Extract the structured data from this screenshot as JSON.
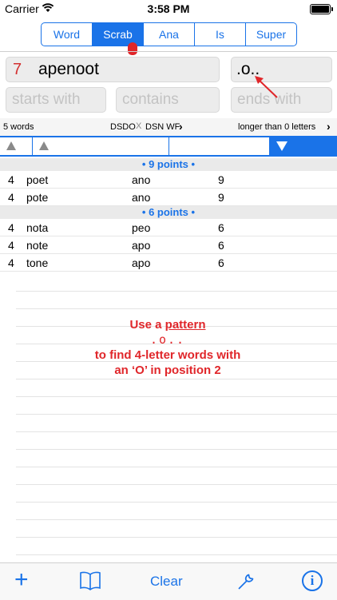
{
  "status_bar": {
    "carrier": "Carrier",
    "time": "3:58 PM"
  },
  "mode_tabs": [
    "Word",
    "Scrab",
    "Ana",
    "Is",
    "Super"
  ],
  "active_tab": "Scrab",
  "letters": {
    "count": "7",
    "value": "apenoot"
  },
  "pattern": {
    "value": ".o.."
  },
  "filters": {
    "starts_placeholder": "starts with",
    "contains_placeholder": "contains",
    "ends_placeholder": "ends with"
  },
  "info_bar": {
    "word_count": "5 words",
    "dict1": "DSDO",
    "dict_sep": "X",
    "dict2": "DSN WF",
    "length_filter": "longer than 0 letters"
  },
  "groups": [
    {
      "label": "• 9 points •",
      "rows": [
        {
          "len": "4",
          "word": "poet",
          "sub": "ano",
          "pts": "9"
        },
        {
          "len": "4",
          "word": "pote",
          "sub": "ano",
          "pts": "9"
        }
      ]
    },
    {
      "label": "• 6 points •",
      "rows": [
        {
          "len": "4",
          "word": "nota",
          "sub": "peo",
          "pts": "6"
        },
        {
          "len": "4",
          "word": "note",
          "sub": "apo",
          "pts": "6"
        },
        {
          "len": "4",
          "word": "tone",
          "sub": "apo",
          "pts": "6"
        }
      ]
    }
  ],
  "annotation": {
    "line1_prefix": "Use a ",
    "line1_link": "pattern",
    "line2": ".o..",
    "line3": "to find 4-letter words with",
    "line4": "an ‘O’ in position 2"
  },
  "toolbar": {
    "clear_label": "Clear"
  },
  "colors": {
    "accent": "#1a73e8",
    "highlight": "#e0262a"
  }
}
